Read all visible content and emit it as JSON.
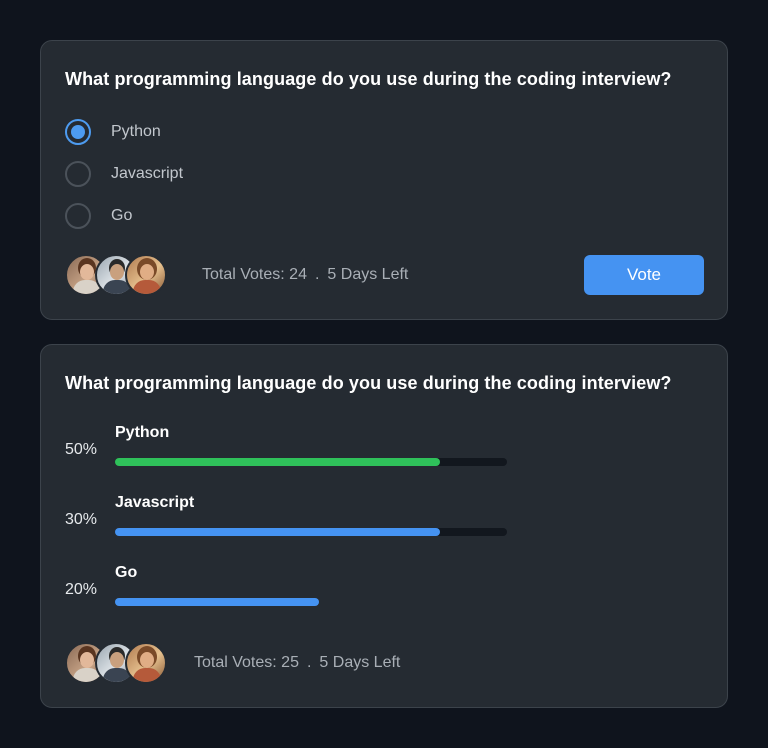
{
  "poll_vote": {
    "question": "What programming language do you use during the coding interview?",
    "options": [
      {
        "label": "Python",
        "selected": true
      },
      {
        "label": "Javascript",
        "selected": false
      },
      {
        "label": "Go",
        "selected": false
      }
    ],
    "total_votes": "Total Votes: 24",
    "separator": ".",
    "days_left": "5 Days Left",
    "vote_label": "Vote"
  },
  "poll_results": {
    "question": "What programming language do you use during the coding interview?",
    "results": [
      {
        "label": "Python",
        "percent": "50%",
        "bar_fill": 0.83,
        "color": "#2fc15a"
      },
      {
        "label": "Javascript",
        "percent": "30%",
        "bar_fill": 0.83,
        "color": "#4593f2"
      },
      {
        "label": "Go",
        "percent": "20%",
        "bar_fill": 0.52,
        "color": "#4593f2",
        "track": false
      }
    ],
    "total_votes": "Total Votes: 25",
    "separator": ".",
    "days_left": "5 Days Left"
  },
  "colors": {
    "background": "#0f141d",
    "card": "#252b32",
    "accent": "#4593f2",
    "success": "#2fc15a"
  },
  "icons": {
    "avatars": [
      "avatar-woman-1",
      "avatar-man",
      "avatar-woman-2"
    ]
  }
}
